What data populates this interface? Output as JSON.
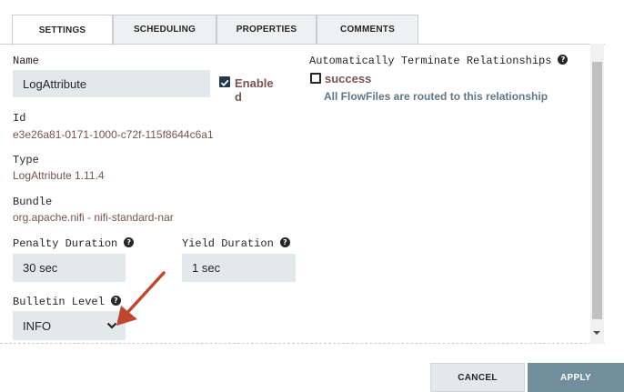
{
  "tabs": [
    "SETTINGS",
    "SCHEDULING",
    "PROPERTIES",
    "COMMENTS"
  ],
  "name": {
    "label": "Name",
    "value": "LogAttribute"
  },
  "enabled": {
    "checked": true,
    "label_line1": "Enable",
    "label_line2": "d"
  },
  "id": {
    "label": "Id",
    "value": "e3e26a81-0171-1000-c72f-115f8644c6a1"
  },
  "type": {
    "label": "Type",
    "value": "LogAttribute 1.11.4"
  },
  "bundle": {
    "label": "Bundle",
    "value": "org.apache.nifi - nifi-standard-nar"
  },
  "penalty": {
    "label": "Penalty Duration",
    "value": "30 sec"
  },
  "yield": {
    "label": "Yield Duration",
    "value": "1 sec"
  },
  "bulletin": {
    "label": "Bulletin Level",
    "value": "INFO"
  },
  "relationships": {
    "label": "Automatically Terminate Relationships",
    "items": [
      {
        "name": "success",
        "checked": false,
        "description": "All FlowFiles are routed to this relationship"
      }
    ]
  },
  "buttons": {
    "cancel": "CANCEL",
    "apply": "APPLY"
  },
  "colors": {
    "value_text": "#775351",
    "description_text": "#5f7788",
    "apply_bg": "#728e9b",
    "annotation_arrow": "#c0472e"
  },
  "help_icon": "?"
}
